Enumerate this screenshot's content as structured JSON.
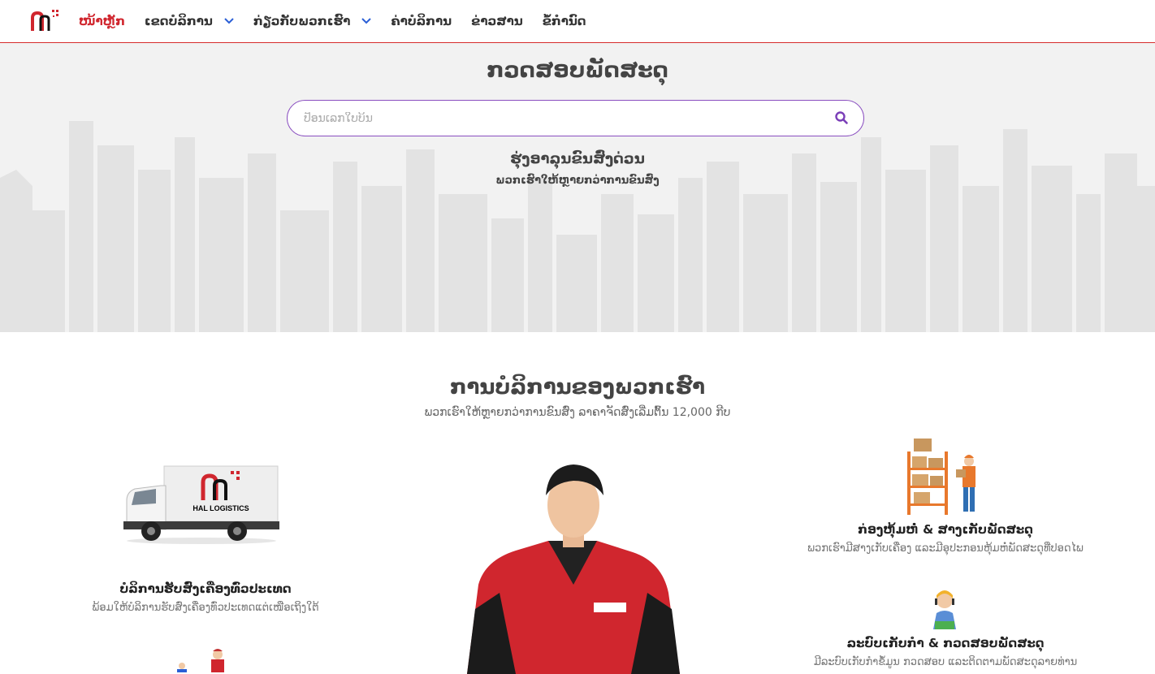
{
  "nav": {
    "items": [
      {
        "label": "ໜ້າຫຼັກ",
        "active": true,
        "dropdown": false
      },
      {
        "label": "ເຂດບໍລິການ",
        "active": false,
        "dropdown": true
      },
      {
        "label": "ກ່ຽວກັບພວກເຮົາ",
        "active": false,
        "dropdown": true
      },
      {
        "label": "ຄ່າບໍລິການ",
        "active": false,
        "dropdown": false
      },
      {
        "label": "ຂ່າວສານ",
        "active": false,
        "dropdown": false
      },
      {
        "label": "ຂໍ້ກຳນົດ",
        "active": false,
        "dropdown": false
      }
    ]
  },
  "hero": {
    "title": "ກວດສອບພັດສະດຸ",
    "search_placeholder": "ປ້ອນເລກໃບບິນ",
    "subtitle": "ຮຸ່ງອາລຸນຂົນສົ່ງດ່ວນ",
    "tagline": "ພວກເຮົາໃຫ້ຫຼາຍກວ່າການຂົນສົ່ງ"
  },
  "services": {
    "title": "ການບໍລິການຂອງພວກເຮົາ",
    "subtitle": "ພວກເຮົາໃຫ້ຫຼາຍກວ່າການຂົນສົ່ງ ລາຄາຈັດສົ່ງເລີ່ມຕົ້ນ 12,000 ກີບ",
    "left": {
      "truck_brand": "HAL LOGISTICS",
      "title": "ບໍລິການຮັບສົ່ງເຄື່ອງທົ່ວປະເທດ",
      "desc": "ພ້ອມໃຫ້ບໍລິການຮັບສົ່ງເຄື່ອງທົ່ວປະເທດແຕ່ເໜືອເຖິງໃຕ້"
    },
    "right_top": {
      "title": "ກ່ອງຫຸ້ມຫໍ່ & ສາງເກັບພັດສະດຸ",
      "desc": "ພວກເຮົາມີສາງເກັບເຄື່ອງ ແລະມີອຸປະກອນຫຸ້ມຫໍ່ພັດສະດຸທີ່ປອດໄພ"
    },
    "right_bottom": {
      "title": "ລະບົບເກັບກຳ & ກວດສອບພັດສະດຸ",
      "desc": "ມີລະບົບເກັບກຳຂໍ້ມູນ ກວດສອບ ແລະຕິດຕາມພັດສະດຸລາຍທ່ານ"
    }
  },
  "colors": {
    "brand_red": "#d0262e",
    "search_border": "#8a4fc0",
    "hero_bg": "#f2f2f2"
  }
}
